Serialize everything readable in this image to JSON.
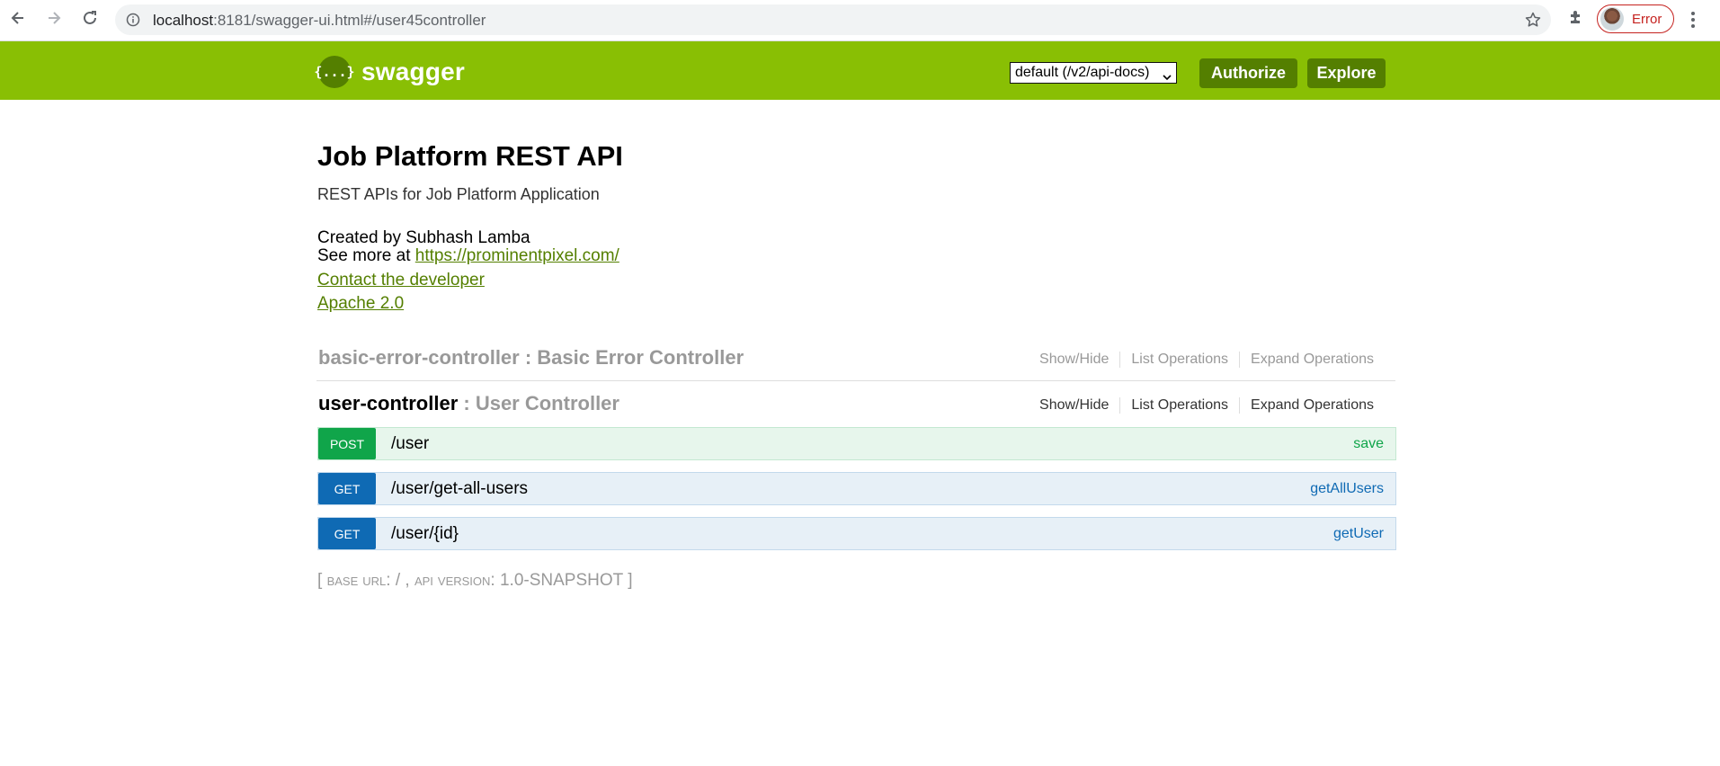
{
  "browser": {
    "url_host": "localhost",
    "url_rest": ":8181/swagger-ui.html#/user45controller",
    "profile_status": "Error"
  },
  "header": {
    "logo_glyph": "{...}",
    "logo_text": "swagger",
    "spec_select_value": "default (/v2/api-docs)",
    "authorize_label": "Authorize",
    "explore_label": "Explore",
    "brand_color": "#89bf04",
    "button_color": "#547f00"
  },
  "info": {
    "title": "Job Platform REST API",
    "description": "REST APIs for Job Platform Application",
    "created_by": "Created by Subhash Lamba",
    "see_more_prefix": "See more at ",
    "see_more_link": "https://prominentpixel.com/",
    "contact": "Contact the developer",
    "license": "Apache 2.0"
  },
  "resources": [
    {
      "name": "basic-error-controller",
      "separator": " : ",
      "description": "Basic Error Controller",
      "ops": [
        "Show/Hide",
        "List Operations",
        "Expand Operations"
      ]
    },
    {
      "name": "user-controller",
      "separator": " : ",
      "description": "User Controller",
      "ops": [
        "Show/Hide",
        "List Operations",
        "Expand Operations"
      ]
    }
  ],
  "operations": [
    {
      "method": "POST",
      "path": "/user",
      "nickname": "save",
      "color": "#10a54a"
    },
    {
      "method": "GET",
      "path": "/user/get-all-users",
      "nickname": "getAllUsers",
      "color": "#0f6ab4"
    },
    {
      "method": "GET",
      "path": "/user/{id}",
      "nickname": "getUser",
      "color": "#0f6ab4"
    }
  ],
  "footer": {
    "open": "[ ",
    "base_url_label": "base url",
    "base_url_value": ": / , ",
    "api_version_label": "api version",
    "api_version_value": ": 1.0-SNAPSHOT ",
    "close": "]"
  }
}
